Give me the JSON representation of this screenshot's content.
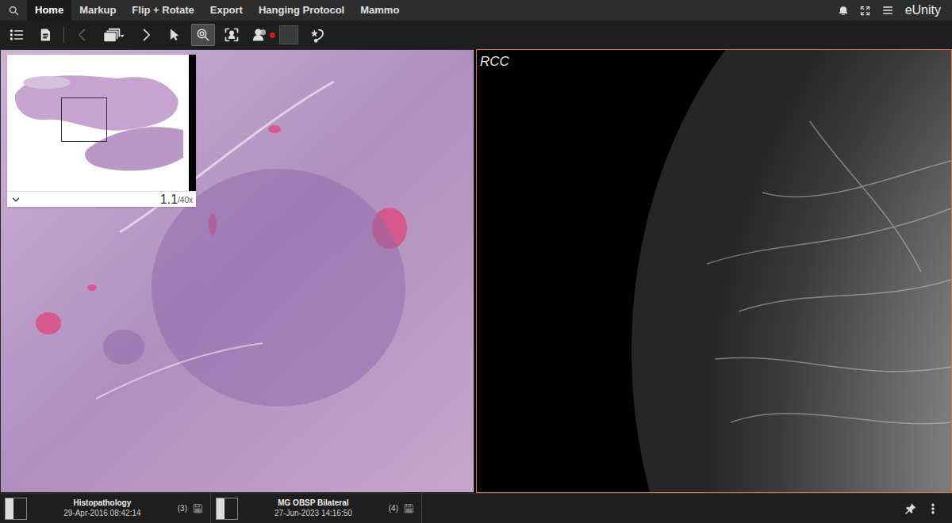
{
  "menu": {
    "tabs": [
      {
        "label": "Home",
        "selected": true
      },
      {
        "label": "Markup",
        "selected": false
      },
      {
        "label": "Flip + Rotate",
        "selected": false
      },
      {
        "label": "Export",
        "selected": false
      },
      {
        "label": "Hanging Protocol",
        "selected": false
      },
      {
        "label": "Mammo",
        "selected": false
      }
    ],
    "actions": [
      {
        "kind": "bell"
      },
      {
        "kind": "fullscreen"
      },
      {
        "kind": "menu"
      }
    ],
    "app_name": "eUnity"
  },
  "toolbar": {
    "tools": [
      {
        "kind": "list",
        "selected": false,
        "disabled": false,
        "indicator": false
      },
      {
        "kind": "document",
        "selected": false,
        "disabled": false,
        "indicator": false
      },
      {
        "kind": "previous",
        "selected": false,
        "disabled": true,
        "indicator": false
      },
      {
        "kind": "series",
        "selected": false,
        "disabled": false,
        "indicator": false
      },
      {
        "kind": "next",
        "selected": false,
        "disabled": false,
        "indicator": false
      },
      {
        "kind": "pointer",
        "selected": false,
        "disabled": false,
        "indicator": false
      },
      {
        "kind": "zoom",
        "selected": true,
        "disabled": false,
        "indicator": false
      },
      {
        "kind": "fit",
        "selected": false,
        "disabled": false,
        "indicator": false
      },
      {
        "kind": "collaborate",
        "selected": false,
        "disabled": false,
        "indicator": true
      },
      {
        "kind": "swatch",
        "selected": false,
        "disabled": false,
        "indicator": false
      },
      {
        "kind": "lasso",
        "selected": false,
        "disabled": false,
        "indicator": false
      }
    ]
  },
  "viewports": [
    {
      "kind": "pathology",
      "selected": false,
      "overview": {
        "zoom": "1.1",
        "max": "/40x",
        "expanded": false
      }
    },
    {
      "kind": "mammogram",
      "selected": true,
      "label": "RCC"
    }
  ],
  "studies": [
    {
      "title": "Histopathology",
      "date": "29-Apr-2016 08:42:14",
      "count": "(3)"
    },
    {
      "title": "MG OBSP Bilateral",
      "date": "27-Jun-2023 14:16:50",
      "count": "(4)"
    }
  ],
  "status_actions": [
    {
      "kind": "pin"
    },
    {
      "kind": "more"
    }
  ]
}
